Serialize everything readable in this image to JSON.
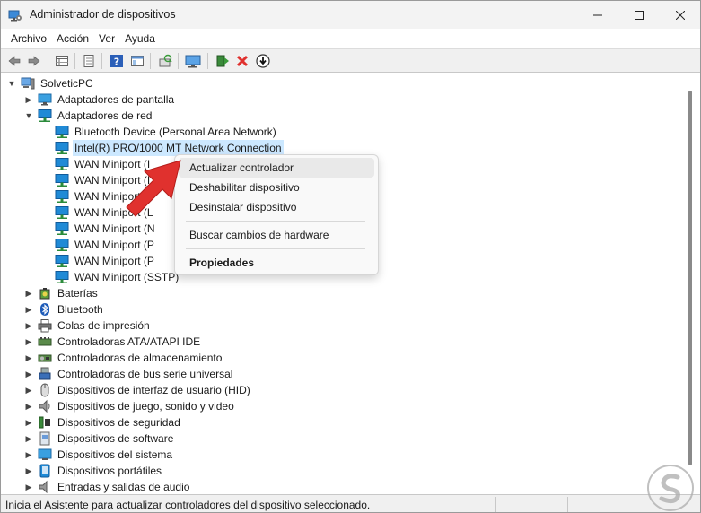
{
  "window": {
    "title": "Administrador de dispositivos",
    "minimize_icon": "minimize-icon",
    "maximize_icon": "maximize-icon",
    "close_icon": "close-icon"
  },
  "menu": {
    "items": [
      "Archivo",
      "Acción",
      "Ver",
      "Ayuda"
    ]
  },
  "toolbar": {
    "icons": [
      "back-arrow-icon",
      "forward-arrow-icon",
      "properties-grid-icon",
      "document-icon",
      "help-icon",
      "view-icon",
      "scan-hardware-icon",
      "monitor-icon",
      "add-driver-icon",
      "uninstall-icon",
      "download-icon"
    ]
  },
  "tree": {
    "root": "SolveticPC",
    "display_adapters": "Adaptadores de pantalla",
    "network_adapters": "Adaptadores de red",
    "network_children": [
      "Bluetooth Device (Personal Area Network)",
      "Intel(R) PRO/1000 MT Network Connection",
      "WAN Miniport (I",
      "WAN Miniport (I",
      "WAN Miniport (I",
      "WAN Miniport (L",
      "WAN Miniport (N",
      "WAN Miniport (P",
      "WAN Miniport (P",
      "WAN Miniport (SSTP)"
    ],
    "categories": [
      "Baterías",
      "Bluetooth",
      "Colas de impresión",
      "Controladoras ATA/ATAPI IDE",
      "Controladoras de almacenamiento",
      "Controladoras de bus serie universal",
      "Dispositivos de interfaz de usuario (HID)",
      "Dispositivos de juego, sonido y video",
      "Dispositivos de seguridad",
      "Dispositivos de software",
      "Dispositivos del sistema",
      "Dispositivos portátiles",
      "Entradas y salidas de audio"
    ]
  },
  "context_menu": {
    "update_driver": "Actualizar controlador",
    "disable_device": "Deshabilitar dispositivo",
    "uninstall_device": "Desinstalar dispositivo",
    "scan_hardware": "Buscar cambios de hardware",
    "properties": "Propiedades"
  },
  "status_bar": {
    "text": "Inicia el Asistente para actualizar controladores del dispositivo seleccionado."
  },
  "colors": {
    "selection": "#cce8ff",
    "network_icon": "#1f8ad6",
    "accent_red": "#e0312e"
  }
}
